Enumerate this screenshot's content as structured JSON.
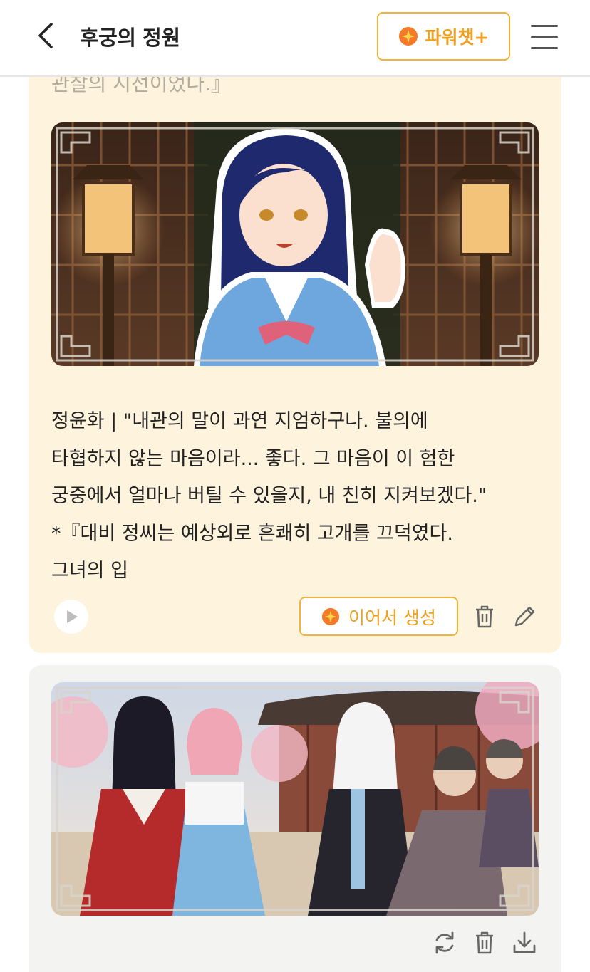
{
  "header": {
    "title": "후궁의 정원",
    "power_label": "파워챗+"
  },
  "card1": {
    "faded_line": "관찰의 시선이었다.』",
    "message_lines": [
      "정윤화 | \"내관의 말이 과연 지엄하구나. 불의에",
      "타협하지 않는 마음이라... 좋다. 그 마음이 이 험한",
      "궁중에서 얼마나 버틸 수 있을지, 내 친히 지켜보겠다.\"",
      "*『대비 정씨는 예상외로 흔쾌히 고개를 끄덕였다.",
      "그녀의 입"
    ],
    "continue_label": "이어서 생성"
  },
  "colors": {
    "accent": "#f0b43a",
    "accent_text": "#f0a020",
    "card_bg": "#fef3dd",
    "card2_bg": "#f3f3f1"
  },
  "icons": {
    "back": "chevron-left-icon",
    "power": "sparkle-icon",
    "menu": "hamburger-icon",
    "play": "play-icon",
    "trash": "trash-icon",
    "edit": "pencil-icon",
    "regenerate": "refresh-icon",
    "download": "download-icon"
  }
}
